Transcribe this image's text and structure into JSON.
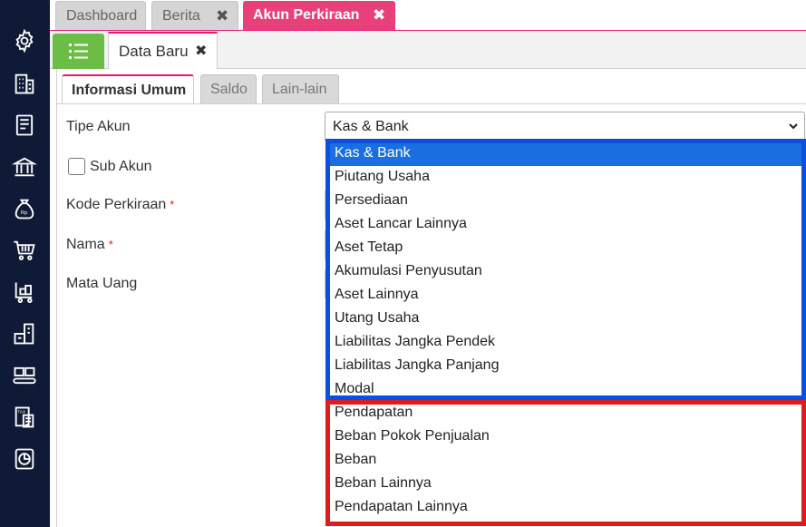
{
  "sidebar": {
    "icons": [
      "gear-icon",
      "building-icon",
      "book-icon",
      "bank-icon",
      "money-bag-icon",
      "cart-icon",
      "delivery-cart-icon",
      "warehouse-icon",
      "conveyor-icon",
      "tax-icon",
      "report-chart-icon"
    ]
  },
  "top_tabs": [
    {
      "label": "Dashboard",
      "active": false,
      "closable": false
    },
    {
      "label": "Berita",
      "active": false,
      "closable": true
    },
    {
      "label": "Akun Perkiraan",
      "active": true,
      "closable": true
    }
  ],
  "close_glyph": "✖",
  "sub_tab": {
    "label": "Data Baru"
  },
  "form_tabs": [
    {
      "label": "Informasi Umum",
      "active": true
    },
    {
      "label": "Saldo",
      "active": false
    },
    {
      "label": "Lain-lain",
      "active": false
    }
  ],
  "form": {
    "tipe_akun_label": "Tipe Akun",
    "sub_akun_label": "Sub Akun",
    "kode_label": "Kode Perkiraan",
    "nama_label": "Nama",
    "mata_uang_label": "Mata Uang",
    "required_mark": "*",
    "tipe_akun_value": "Kas & Bank"
  },
  "dropdown": {
    "options": [
      "Kas & Bank",
      "Piutang Usaha",
      "Persediaan",
      "Aset Lancar Lainnya",
      "Aset Tetap",
      "Akumulasi Penyusutan",
      "Aset Lainnya",
      "Utang Usaha",
      "Liabilitas Jangka Pendek",
      "Liabilitas Jangka Panjang",
      "Modal",
      "Pendapatan",
      "Beban Pokok Penjualan",
      "Beban",
      "Beban Lainnya",
      "Pendapatan Lainnya"
    ],
    "selected_index": 0
  },
  "colors": {
    "sidebar_bg": "#0f1b36",
    "active_tab": "#e8417a",
    "menu_button": "#6bbd45",
    "selected_option": "#1a6ee0",
    "highlight_blue": "#0b4fe0",
    "highlight_red": "#e01b1b"
  }
}
